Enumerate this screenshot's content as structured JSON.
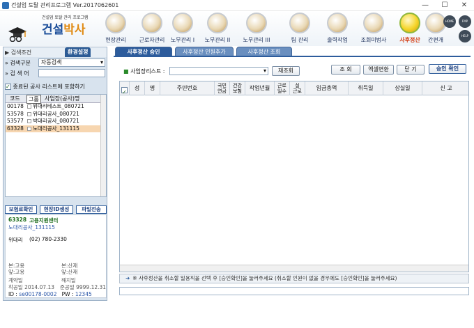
{
  "window": {
    "title": "건설업 토탈 관리프로그램 Ver.2017062601",
    "controls": [
      "—",
      "☐",
      "✕"
    ]
  },
  "brand": {
    "tagline": "건설업 토탈 관리 프로그램",
    "name_part1": "건설",
    "name_part2": "박사",
    "accent": "#e08a12",
    "primary": "#1d4f9a"
  },
  "menu": [
    {
      "label": "현장관리"
    },
    {
      "label": "근로자관리"
    },
    {
      "label": "노무관리 I"
    },
    {
      "label": "노무관리 II"
    },
    {
      "label": "노무관리 III"
    },
    {
      "label": "팀 관리"
    },
    {
      "label": "출력작업"
    },
    {
      "label": "조회미법사"
    },
    {
      "label": "사후정산"
    },
    {
      "label": "간편개"
    }
  ],
  "side_buttons": [
    "HOME",
    "FMP",
    "HELP"
  ],
  "left_panel": {
    "tab_search": "검색조건",
    "tab_settings": "환경설정",
    "search_type_label": "검색구분",
    "search_type_value": "자동검색",
    "search_word_label": "검 색 어",
    "include_finished_label": "종료된 공사 리스트에 포함하기",
    "list_headers": {
      "code": "코드",
      "group": "그룹",
      "site": "사업장(공사)명"
    },
    "rows": [
      {
        "code": "00178",
        "name": "위대리테스트_080721",
        "highlight": false
      },
      {
        "code": "53578",
        "name": "위대리공사_080721",
        "highlight": false
      },
      {
        "code": "53577",
        "name": "박대리공사_080721",
        "highlight": false
      },
      {
        "code": "63328",
        "name": "노대리공사_131115",
        "highlight": true
      }
    ],
    "buttons": {
      "insurance": "보험료확인",
      "site_id": "현장ID생성",
      "file_send": "파일전송"
    },
    "info": {
      "code": "63328",
      "agency": "고용지원센터",
      "site_name": "노대리공사_131115",
      "contact_name": "위대리",
      "phone": "(02) 780-2330",
      "headquarters_employ": "본:고용",
      "headquarters_accident": "본:산재",
      "branch_employ": "앞:고용",
      "branch_accident": "앞:산재",
      "contract_label": "계약일",
      "termination_label": "해지일",
      "start_label": "착공일",
      "start_date": "2014.07.13",
      "completion_label": "준공일",
      "completion_date": "9999.12.31",
      "id_label": "ID :",
      "id_value": "se00178-0002",
      "pw_label": "PW :",
      "pw_value": "12345"
    }
  },
  "main": {
    "tabs": [
      "사후정산 승인",
      "사후정산 인원추가",
      "사후정산 조회"
    ],
    "site_list_label": "사업장리스트 :",
    "site_list_value": "",
    "requery_button": "재조회",
    "buttons": {
      "query": "조 회",
      "excel": "엑셀변환",
      "close": "닫 기",
      "approve": "승인 확인"
    },
    "columns": [
      "성",
      "명",
      "주민번호",
      "국민\n연금",
      "건강\n보험",
      "작업년월",
      "근로\n일수",
      "실\n근로",
      "임금총액",
      "취득일",
      "상실일",
      "신 고"
    ],
    "notice": "※ 사후정산을 취소할 일용직을 선택 후 [승인확인]을 눌러주세요 (취소할 인원이 없을 경우에도 [승인확인]을 눌러주세요)"
  }
}
